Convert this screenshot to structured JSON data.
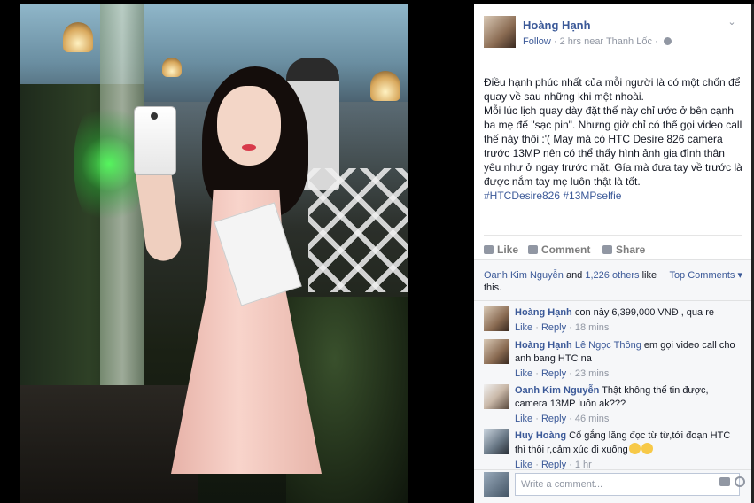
{
  "post": {
    "author": "Hoàng Hạnh",
    "follow": "Follow",
    "meta": " · 2 hrs near Thanh Lốc · ",
    "text_lines": [
      "Điều hạnh phúc nhất của mỗi người là có một chốn để quay về sau những khi mệt nhoài.",
      "Mỗi lúc lịch quay dày đặt thế này chỉ ước ở bên cạnh ba mẹ để \"sạc pin\". Nhưng giờ chỉ có thể gọi video call thế này thôi :'( May mà có HTC Desire 826 camera trước 13MP nên có thể thấy hình ảnh gia đình thân yêu như ở ngay trước mặt. Gía mà đưa tay về trước là được nắm tay mẹ luôn thật là tốt."
    ],
    "hashtags": "#HTCDesire826 #13MPselfie"
  },
  "actions": {
    "like": "Like",
    "comment": "Comment",
    "share": "Share"
  },
  "likes": {
    "name": "Oanh Kim Nguyễn",
    "and": " and ",
    "others": "1,226 others",
    "suffix": " like this.",
    "top_comments": "Top Comments ▾"
  },
  "comments": [
    {
      "name": "Hoàng Hạnh",
      "text": " con này 6,399,000 VNĐ , qua re",
      "like": "Like",
      "reply": "Reply",
      "time": " · 18 mins"
    },
    {
      "name": "Hoàng Hạnh",
      "mention": " Lê Ngọc Thông",
      "text": " em gọi video call cho anh bang HTC na",
      "like": "Like",
      "reply": "Reply",
      "time": " · 23 mins"
    },
    {
      "name": "Oanh Kim Nguyễn",
      "text": " Thật không thể tin được, camera 13MP luôn ak???",
      "like": "Like",
      "reply": "Reply",
      "time": " · 46 mins"
    },
    {
      "name": "Huy Hoàng",
      "text": " Cố gắng lăng đọc từ từ,tới đoạn HTC thì thôi r,cảm xúc đi xuống",
      "like": "Like",
      "reply": "Reply",
      "time": " · 1 hr"
    }
  ],
  "write": {
    "placeholder": "Write a comment..."
  },
  "icons": {
    "options": "chevron-down-icon",
    "privacy": "globe-icon",
    "like": "thumbs-up-icon",
    "comment": "speech-bubble-icon",
    "share": "share-arrow-icon",
    "camera": "camera-icon",
    "sticker": "smiley-icon"
  },
  "colors": {
    "link": "#3b5998",
    "muted": "#9197a3",
    "panel_bg": "#f6f7f9"
  }
}
